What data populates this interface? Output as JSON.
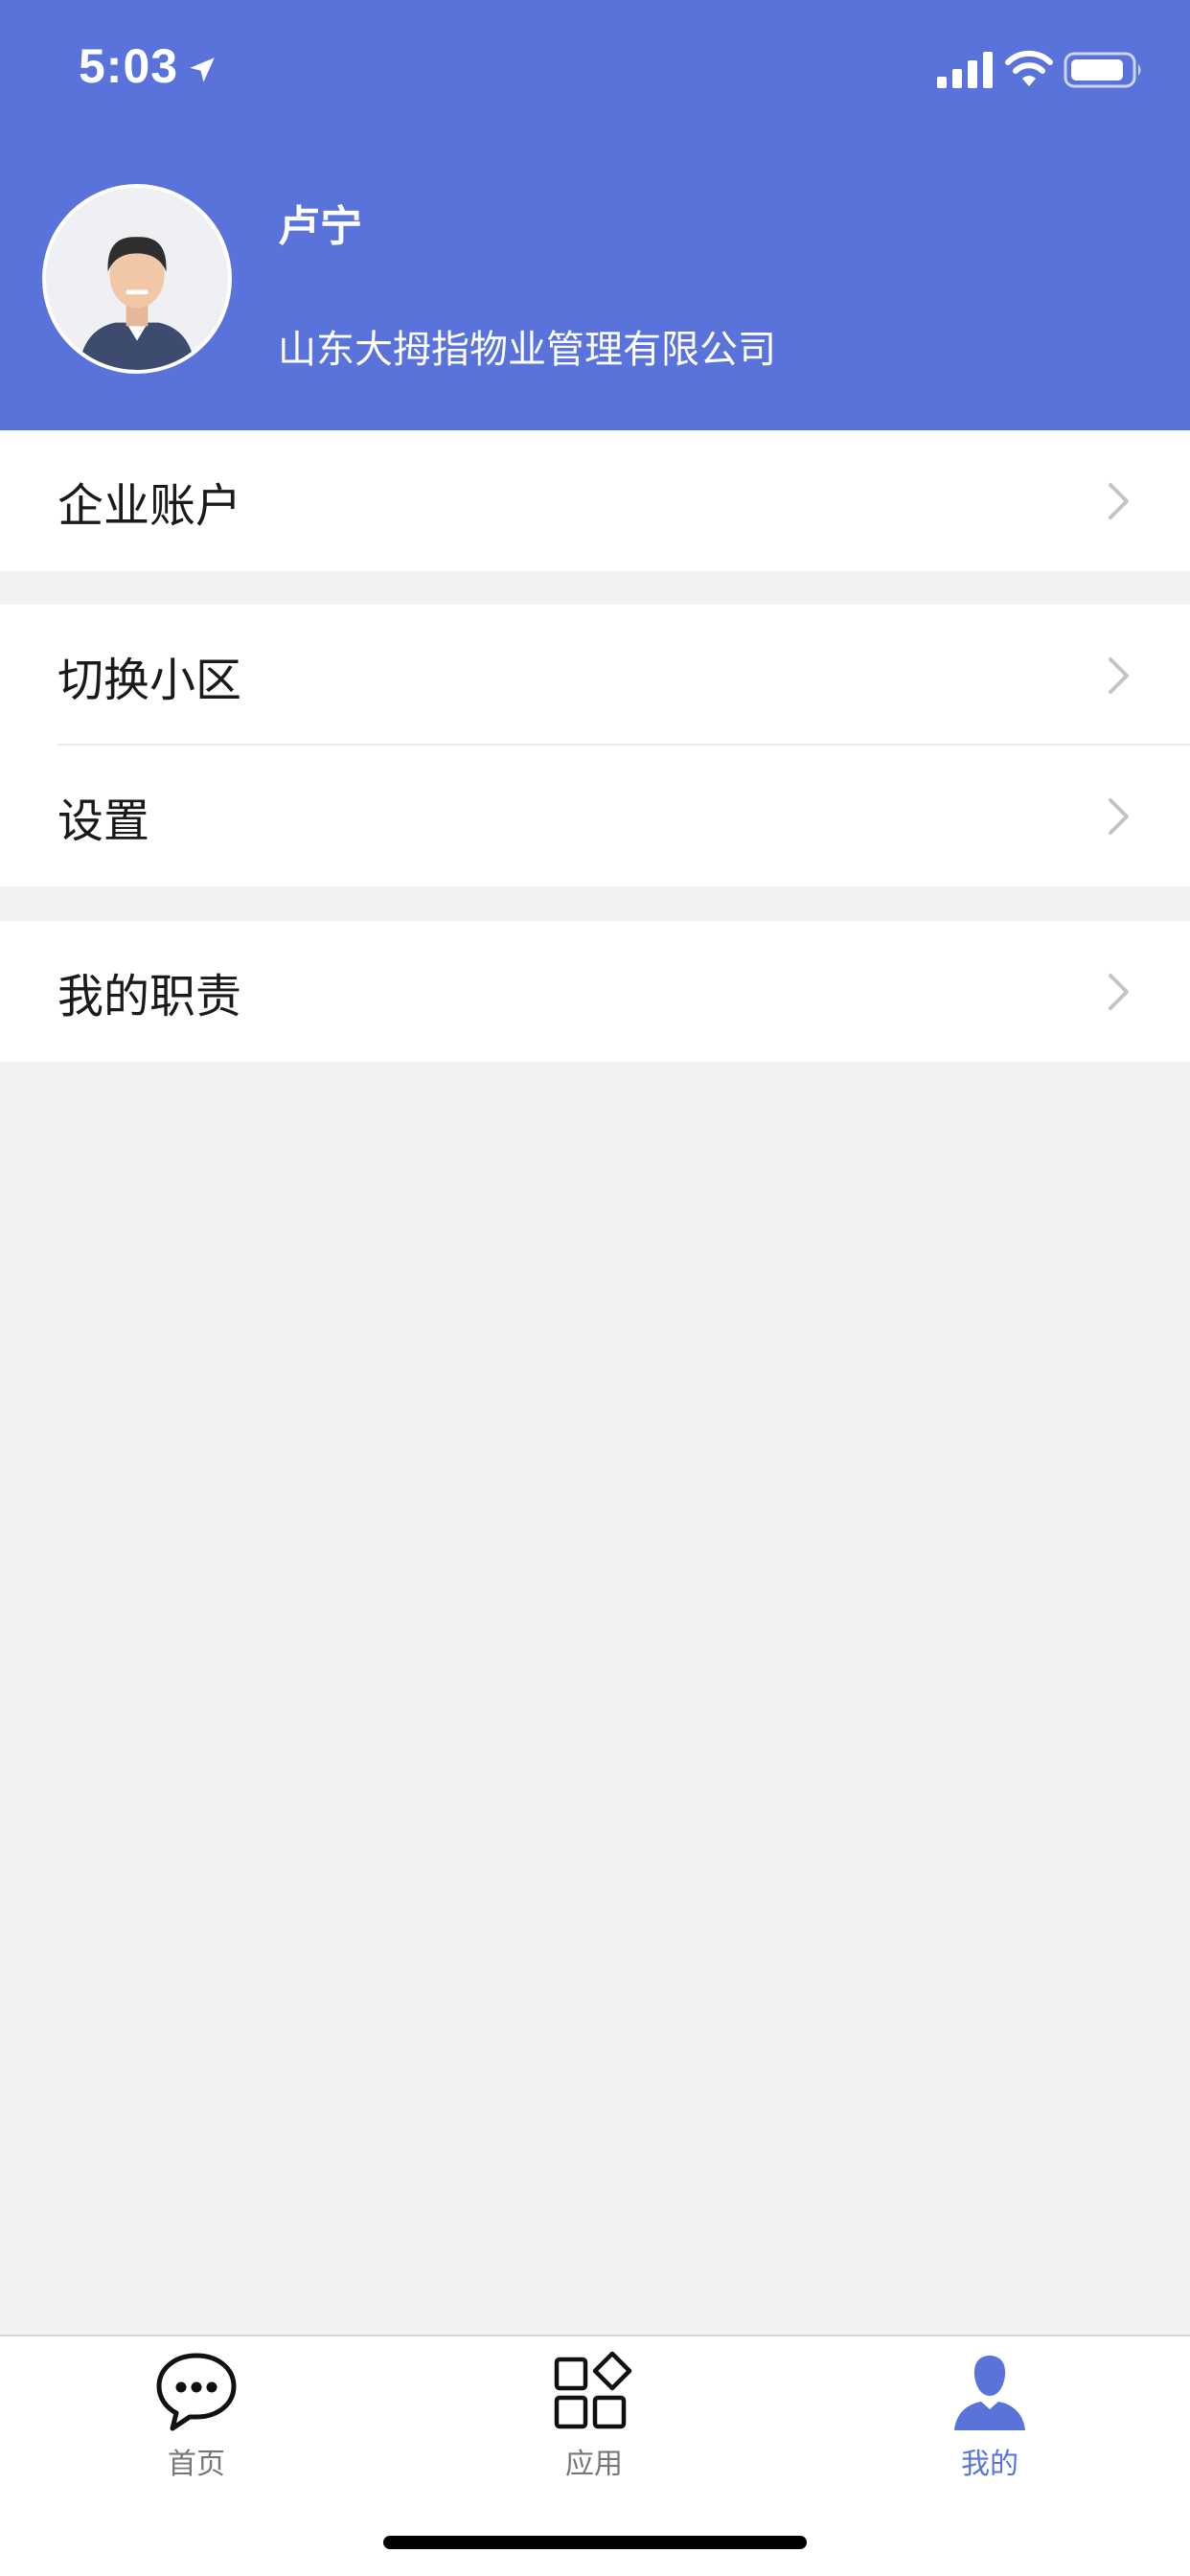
{
  "status_bar": {
    "time": "5:03",
    "icons": [
      "location-arrow-icon",
      "cellular-signal-icon",
      "wifi-icon",
      "battery-icon"
    ]
  },
  "profile": {
    "name": "卢宁",
    "company": "山东大拇指物业管理有限公司",
    "avatar_icon": "user-avatar-icon"
  },
  "menu": {
    "groups": [
      {
        "items": [
          {
            "label": "企业账户",
            "icon": "chevron-right-icon"
          }
        ]
      },
      {
        "items": [
          {
            "label": "切换小区",
            "icon": "chevron-right-icon"
          },
          {
            "label": "设置",
            "icon": "chevron-right-icon"
          }
        ]
      },
      {
        "items": [
          {
            "label": "我的职责",
            "icon": "chevron-right-icon"
          }
        ]
      }
    ]
  },
  "tabbar": {
    "tabs": [
      {
        "label": "首页",
        "icon": "chat-bubble-icon",
        "active": false
      },
      {
        "label": "应用",
        "icon": "apps-grid-icon",
        "active": false
      },
      {
        "label": "我的",
        "icon": "person-icon",
        "active": true
      }
    ]
  },
  "colors": {
    "brand": "#5a73db",
    "background": "#f2f2f2",
    "chevron": "#c4c4c4"
  }
}
